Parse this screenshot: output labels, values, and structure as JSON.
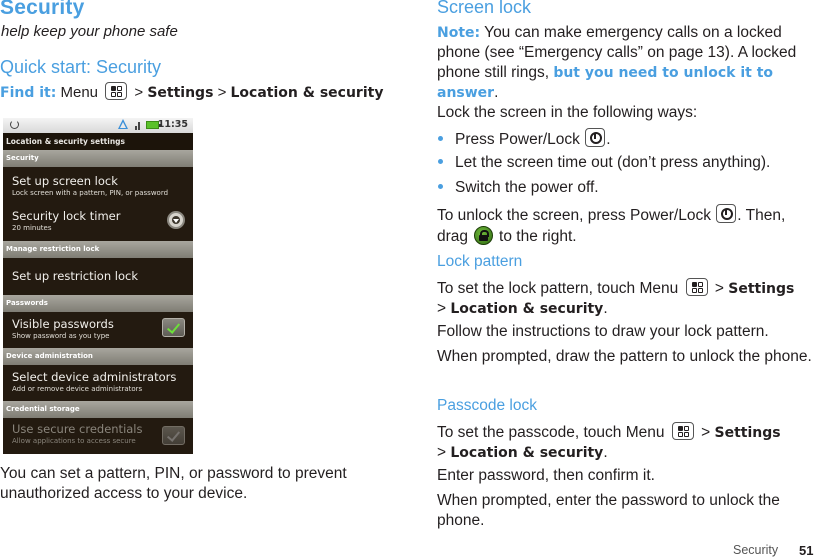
{
  "page": {
    "title": "Security",
    "subtitle": "help keep your phone safe",
    "quick_start": {
      "heading": "Quick start: Security",
      "find_it_label": "Find it:",
      "find_it_menu": "Menu",
      "sep1": ">",
      "settings": "Settings",
      "sep2": ">",
      "location_security": "Location & security"
    },
    "caption": "You can set a pattern, PIN, or password to prevent unauthorized access to your device.",
    "footer": {
      "section": "Security",
      "page_number": "51"
    }
  },
  "phone": {
    "status_bar": {
      "icons": [
        "sync-icon",
        "warning-icon",
        "signal-icon",
        "battery-icon"
      ],
      "time": "11:35"
    },
    "screen_title": "Location & security settings",
    "sections": [
      {
        "header": "Security",
        "items": [
          {
            "title": "Set up screen lock",
            "summary": "Lock screen with a pattern, PIN, or password",
            "control": "none"
          },
          {
            "title": "Security lock timer",
            "summary": "20 minutes",
            "control": "dropdown"
          }
        ]
      },
      {
        "header": "Manage restriction lock",
        "items": [
          {
            "title": "Set up restriction lock",
            "summary": "",
            "control": "none"
          }
        ]
      },
      {
        "header": "Passwords",
        "items": [
          {
            "title": "Visible passwords",
            "summary": "Show password as you type",
            "control": "checkbox",
            "checked": true
          }
        ]
      },
      {
        "header": "Device administration",
        "items": [
          {
            "title": "Select device administrators",
            "summary": "Add or remove device administrators",
            "control": "none"
          }
        ]
      },
      {
        "header": "Credential storage",
        "items": [
          {
            "title": "Use secure credentials",
            "summary": "Allow applications to access secure",
            "control": "checkbox",
            "checked": true,
            "disabled": true
          }
        ]
      }
    ]
  },
  "right": {
    "screen_lock": {
      "heading": "Screen lock",
      "note_label": "Note:",
      "note_text": " You can make emergency calls on a locked phone (see “Emergency calls” on page 13). A locked phone still rings, ",
      "note_emphasis": "but you need to unlock it to answer",
      "note_end": ".",
      "intro": "Lock the screen in the following ways:",
      "bullets": [
        {
          "text": "Press Power/Lock",
          "suffix": ".",
          "icon": "power-key-icon"
        },
        {
          "text": "Let the screen time out (don’t press anything).",
          "suffix": ""
        },
        {
          "text": "Switch the power off.",
          "suffix": ""
        }
      ],
      "unlock_1": "To unlock the screen, press Power/Lock",
      "unlock_2": ". Then,",
      "unlock_3": "drag",
      "unlock_4": "to the right."
    },
    "lock_pattern": {
      "heading": "Lock pattern",
      "p1_a": "To set the lock pattern, touch Menu",
      "p1_sep1": ">",
      "p1_settings": "Settings",
      "p1_sep2": ">",
      "p1_loc": "Location & security",
      "p1_end": ".",
      "p2": "Follow the instructions to draw your lock pattern.",
      "p3": "When prompted, draw the pattern to unlock the phone."
    },
    "passcode_lock": {
      "heading": "Passcode lock",
      "p1_a": "To set the passcode, touch Menu",
      "p1_sep1": ">",
      "p1_settings": "Settings",
      "p1_sep2": ">",
      "p1_loc": "Location & security",
      "p1_end": ".",
      "p2": "Enter password, then confirm it.",
      "p3": "When prompted, enter the password to unlock the phone."
    }
  },
  "colors": {
    "accent_blue": "#4a9fe0",
    "text": "#231f20",
    "phone_bg": "#231a10",
    "section_header": "#8f8d85",
    "check_green": "#6de03a"
  }
}
